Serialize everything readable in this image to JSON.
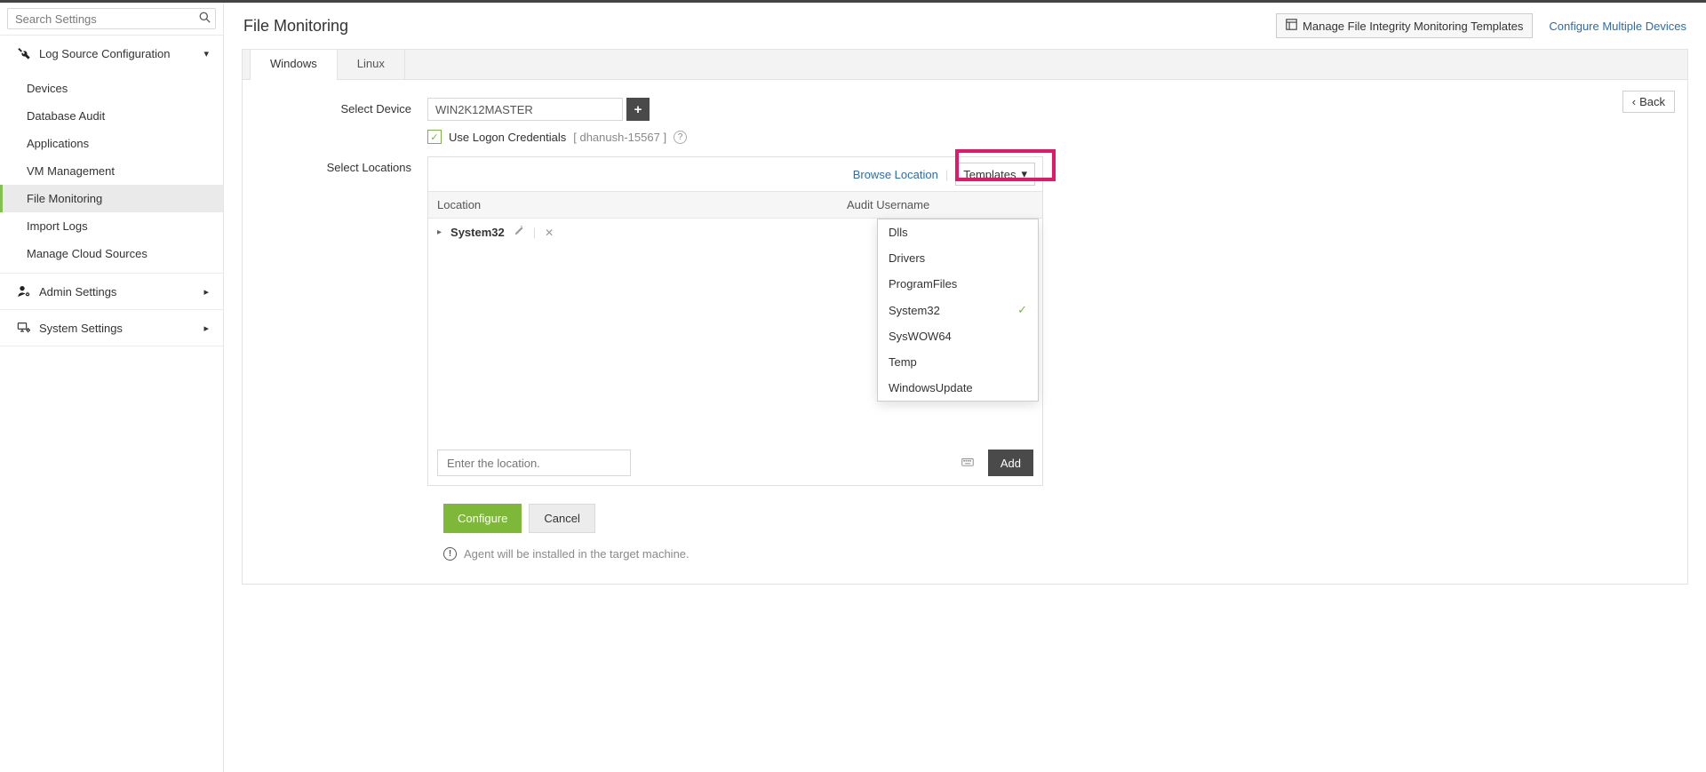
{
  "search": {
    "placeholder": "Search Settings"
  },
  "sidebar": {
    "sections": [
      {
        "label": "Log Source Configuration",
        "expanded": true,
        "items": [
          {
            "label": "Devices"
          },
          {
            "label": "Database Audit"
          },
          {
            "label": "Applications"
          },
          {
            "label": "VM Management"
          },
          {
            "label": "File Monitoring",
            "active": true
          },
          {
            "label": "Import Logs"
          },
          {
            "label": "Manage Cloud Sources"
          }
        ]
      },
      {
        "label": "Admin Settings",
        "expanded": false
      },
      {
        "label": "System Settings",
        "expanded": false
      }
    ]
  },
  "header": {
    "title": "File Monitoring",
    "manageTemplates": "Manage File Integrity Monitoring Templates",
    "configureMultiple": "Configure Multiple Devices"
  },
  "tabs": [
    {
      "label": "Windows",
      "active": true
    },
    {
      "label": "Linux"
    }
  ],
  "back": "Back",
  "form": {
    "selectDevice": {
      "label": "Select Device",
      "value": "WIN2K12MASTER"
    },
    "useLogon": {
      "label": "Use Logon Credentials",
      "user": "[ dhanush-15567 ]",
      "checked": true
    },
    "selectLocations": {
      "label": "Select Locations"
    }
  },
  "locations": {
    "browseLocation": "Browse Location",
    "templatesLabel": "Templates",
    "columns": {
      "location": "Location",
      "auditUsername": "Audit Username"
    },
    "rows": [
      {
        "name": "System32"
      }
    ],
    "footer": {
      "placeholder": "Enter the location.",
      "addLabel": "Add"
    },
    "dropdown": [
      {
        "label": "Dlls"
      },
      {
        "label": "Drivers"
      },
      {
        "label": "ProgramFiles"
      },
      {
        "label": "System32",
        "selected": true
      },
      {
        "label": "SysWOW64"
      },
      {
        "label": "Temp"
      },
      {
        "label": "WindowsUpdate"
      }
    ]
  },
  "actions": {
    "configure": "Configure",
    "cancel": "Cancel"
  },
  "note": "Agent will be installed in the target machine."
}
